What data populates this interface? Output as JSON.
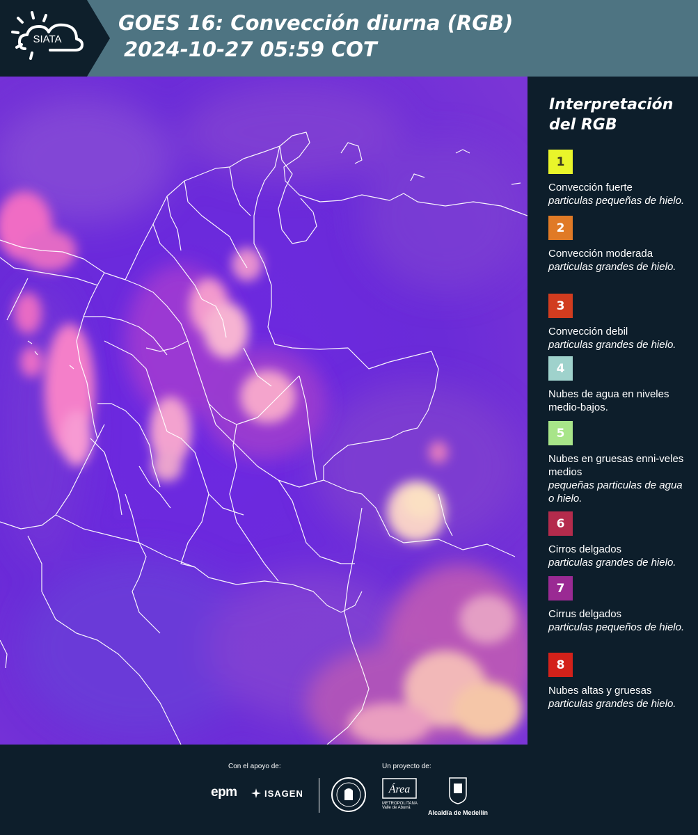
{
  "header": {
    "logo_text": "SIATA",
    "title_line1": "GOES 16: Convección diurna (RGB)",
    "title_line2": "2024-10-27 05:59 COT"
  },
  "legend": {
    "title": "Interpretación del RGB",
    "items": [
      {
        "number": "1",
        "color": "#e9f52a",
        "number_color": "#3a3a20",
        "label": "Convección fuerte",
        "sub": "particulas pequeñas de hielo."
      },
      {
        "number": "2",
        "color": "#e07a26",
        "number_color": "#ffffff",
        "label": "Convección moderada",
        "sub": "particulas grandes de hielo."
      },
      {
        "number": "3",
        "color": "#d13c1f",
        "number_color": "#ffffff",
        "label": "Convección debil",
        "sub": "particulas grandes de hielo."
      },
      {
        "number": "4",
        "color": "#9fd2cc",
        "number_color": "#ffffff",
        "label": "Nubes de agua en niveles medio-bajos.",
        "sub": ""
      },
      {
        "number": "5",
        "color": "#a8e589",
        "number_color": "#ffffff",
        "label": "Nubes en gruesas enni-veles medios",
        "sub": "pequeñas particulas de agua o hielo."
      },
      {
        "number": "6",
        "color": "#b42b4c",
        "number_color": "#ffffff",
        "label": "Cirros delgados",
        "sub": "particulas grandes de hielo."
      },
      {
        "number": "7",
        "color": "#9a2a93",
        "number_color": "#ffffff",
        "label": "Cirrus delgados",
        "sub": "particulas pequeños de hielo."
      },
      {
        "number": "8",
        "color": "#d3211a",
        "number_color": "#ffffff",
        "label": "Nubes altas y gruesas",
        "sub": "particulas grandes de hielo."
      }
    ]
  },
  "footer": {
    "support_label": "Con el apoyo de:",
    "project_label": "Un proyecto de:",
    "sponsor_1": "epm",
    "sponsor_2": "ISAGEN",
    "partner_area": "Área",
    "partner_area_sub1": "METROPOLITANA",
    "partner_area_sub2": "Valle de Aburrá",
    "partner_alcaldia": "Alcaldía de Medellín"
  }
}
